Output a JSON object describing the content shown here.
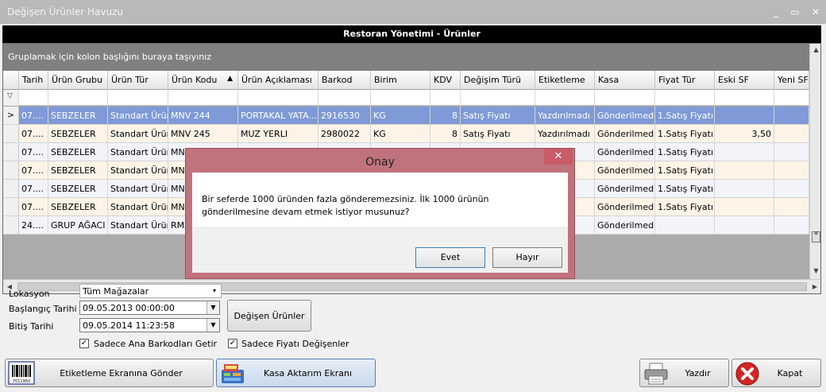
{
  "window": {
    "title": "Değişen Ürünler Havuzu",
    "min_glyph": "_",
    "max_glyph": "▭",
    "close_glyph": "✕"
  },
  "pane_header": "Restoran Yönetimi - Ürünler",
  "grid": {
    "group_panel_text": "Gruplamak için kolon başlığını buraya taşıyınız",
    "sort_arrow": "▲",
    "filter_glyph": "▽",
    "columns": [
      "Tarih",
      "Ürün Grubu",
      "Ürün Tür",
      "Ürün Kodu",
      "Ürün Açıklaması",
      "Barkod",
      "Birim",
      "KDV",
      "Değişim Türü",
      "Etiketleme",
      "Kasa",
      "Fiyat Tür",
      "Eski SF",
      "Yeni SF"
    ],
    "current_row_glyph": ">",
    "rows": [
      [
        "07....",
        "SEBZELER",
        "Standart Ürün",
        "MNV 244",
        "PORTAKAL YATA...",
        "2916530",
        "KG",
        "8",
        "Satış Fiyatı",
        "Yazdırılmadı",
        "Gönderilmedi",
        "1.Satış Fiyatı",
        "",
        ""
      ],
      [
        "07....",
        "SEBZELER",
        "Standart Ürün",
        "MNV 245",
        "MUZ  YERLI",
        "2980022",
        "KG",
        "8",
        "Satış Fiyatı",
        "Yazdırılmadı",
        "Gönderilmedi",
        "1.Satış Fiyatı",
        "3,50",
        ""
      ],
      [
        "07....",
        "SEBZELER",
        "Standart Ürün",
        "MNV",
        "",
        "",
        "",
        "",
        "",
        "",
        "Gönderilmedi",
        "1.Satış Fiyatı",
        "",
        ""
      ],
      [
        "07....",
        "SEBZELER",
        "Standart Ürün",
        "MNV",
        "",
        "",
        "",
        "",
        "",
        "",
        "Gönderilmedi",
        "1.Satış Fiyatı",
        "",
        ""
      ],
      [
        "07....",
        "SEBZELER",
        "Standart Ürün",
        "MNV",
        "",
        "",
        "",
        "",
        "",
        "",
        "Gönderilmedi",
        "1.Satış Fiyatı",
        "",
        ""
      ],
      [
        "07....",
        "SEBZELER",
        "Standart Ürün",
        "MNV",
        "",
        "",
        "",
        "",
        "",
        "",
        "Gönderilmedi",
        "1.Satış Fiyatı",
        "",
        ""
      ],
      [
        "24....",
        "GRUP AĞACI",
        "Standart Ürün",
        "RMZ",
        "",
        "",
        "",
        "",
        "",
        "",
        "Gönderilmedi",
        "",
        "",
        ""
      ]
    ]
  },
  "filters": {
    "lokasyon_label": "Lokasyon",
    "lokasyon_value": "Tüm Mağazalar",
    "start_label": "Başlangıç Tarihi",
    "start_value": "09.05.2013 00:00:00",
    "end_label": "Bitiş Tarihi",
    "end_value": "09.05.2014 11:23:58",
    "changed_button": "Değişen Ürünler",
    "chk_barcode_label": "Sadece Ana Barkodları Getir",
    "chk_price_label": "Sadece Fiyatı Değişenler",
    "check_glyph": "✓",
    "dropdown_glyph": "▼"
  },
  "actions": {
    "label_screen": "Etiketleme Ekranına Gönder",
    "cash_transfer": "Kasa Aktarım Ekranı",
    "print": "Yazdır",
    "close": "Kapat",
    "barcode_digits": "7011950"
  },
  "dialog": {
    "title": "Onay",
    "message": "Bir seferde 1000 üründen fazla gönderemezsiniz. İlk 1000 ürünün gönderilmesine devam etmek istiyor musunuz?",
    "yes": "Evet",
    "no": "Hayır",
    "close_glyph": "✕"
  },
  "colors": {
    "selected_row": "#7f9ad6",
    "odd_row": "#f2f4fa",
    "even_row": "#fdf4e7",
    "dialog_frame": "#c0737c"
  }
}
